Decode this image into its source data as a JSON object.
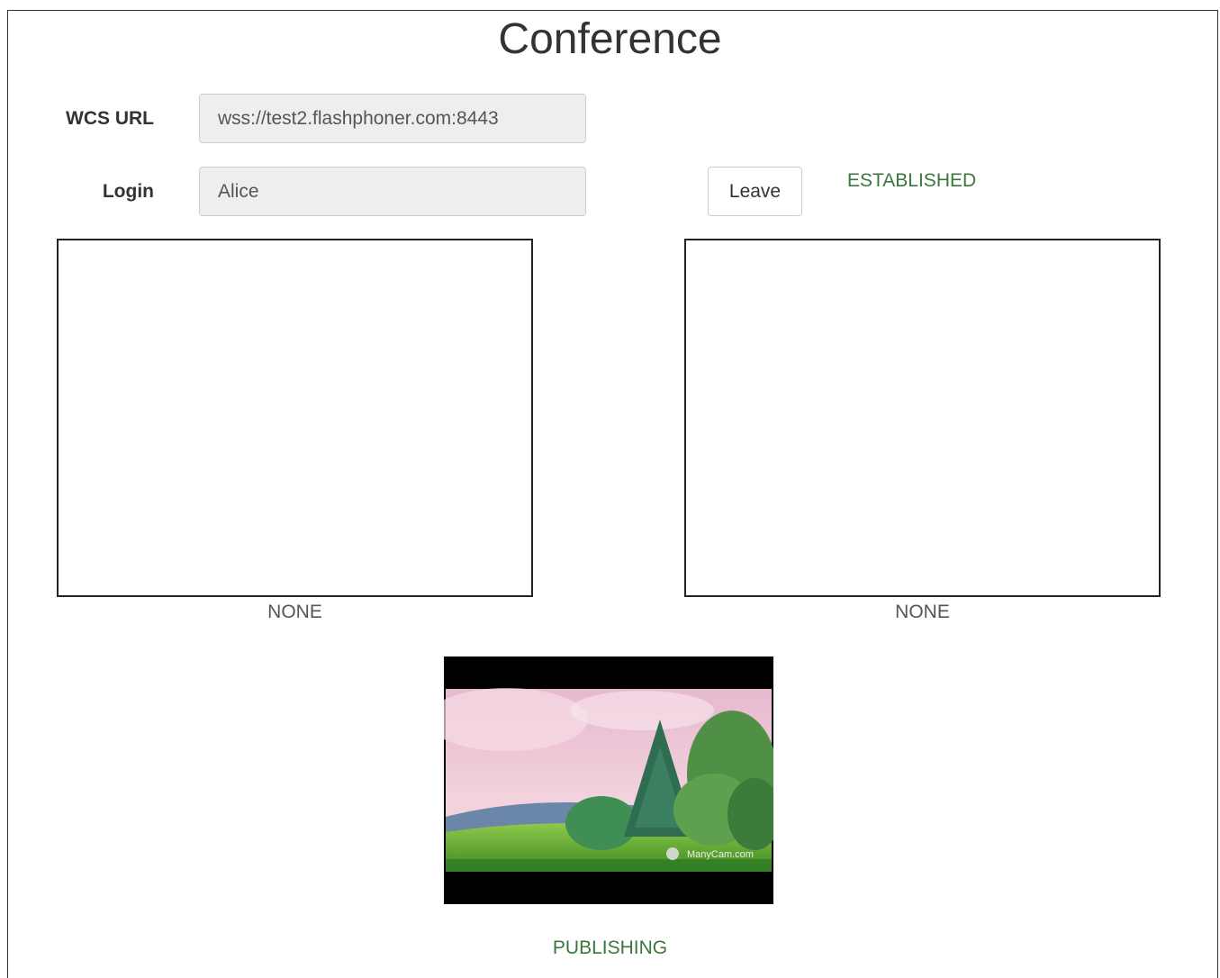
{
  "page": {
    "title": "Conference"
  },
  "form": {
    "wcs_url_label": "WCS URL",
    "wcs_url_value": "wss://test2.flashphoner.com:8443",
    "login_label": "Login",
    "login_value": "Alice",
    "leave_button": "Leave",
    "connection_status": "ESTABLISHED"
  },
  "participants": [
    {
      "status": "NONE"
    },
    {
      "status": "NONE"
    }
  ],
  "local": {
    "watermark": "ManyCam.com",
    "status": "PUBLISHING"
  },
  "colors": {
    "status_green": "#3c763d",
    "input_bg": "#eeeeee",
    "border": "#222222"
  }
}
